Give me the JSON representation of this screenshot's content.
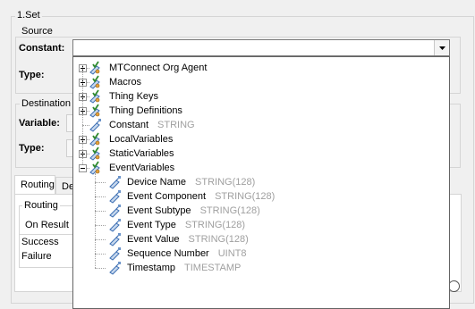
{
  "set_group": {
    "title": "1.Set"
  },
  "source": {
    "title": "Source",
    "constant_label": "Constant:",
    "constant_value": "",
    "type_label": "Type:"
  },
  "destination": {
    "title": "Destination",
    "variable_label": "Variable:",
    "type_label": "Type:"
  },
  "tabs": [
    {
      "label": "Routing",
      "selected": true
    },
    {
      "label": "Def",
      "selected": false
    }
  ],
  "routing": {
    "title": "Routing",
    "on_result_label": "On Result",
    "rows": [
      "Success",
      "Failure"
    ]
  },
  "tree": [
    {
      "label": "MTConnect Org Agent",
      "type": "",
      "level": 0,
      "expander": "plus",
      "icon": "folder-check-icon"
    },
    {
      "label": "Macros",
      "type": "",
      "level": 0,
      "expander": "plus",
      "icon": "folder-check-icon"
    },
    {
      "label": "Thing Keys",
      "type": "",
      "level": 0,
      "expander": "plus",
      "icon": "folder-check-icon"
    },
    {
      "label": "Thing Definitions",
      "type": "",
      "level": 0,
      "expander": "plus",
      "icon": "folder-check-icon"
    },
    {
      "label": "Constant",
      "type": "STRING",
      "level": 0,
      "expander": "none",
      "icon": "variable-icon"
    },
    {
      "label": "LocalVariables",
      "type": "",
      "level": 0,
      "expander": "plus",
      "icon": "folder-check-icon"
    },
    {
      "label": "StaticVariables",
      "type": "",
      "level": 0,
      "expander": "plus",
      "icon": "folder-check-icon"
    },
    {
      "label": "EventVariables",
      "type": "",
      "level": 0,
      "expander": "minus",
      "icon": "folder-check-icon"
    },
    {
      "label": "Device Name",
      "type": "STRING(128)",
      "level": 1,
      "expander": "none",
      "icon": "variable-icon"
    },
    {
      "label": "Event Component",
      "type": "STRING(128)",
      "level": 1,
      "expander": "none",
      "icon": "variable-icon"
    },
    {
      "label": "Event Subtype",
      "type": "STRING(128)",
      "level": 1,
      "expander": "none",
      "icon": "variable-icon"
    },
    {
      "label": "Event Type",
      "type": "STRING(128)",
      "level": 1,
      "expander": "none",
      "icon": "variable-icon"
    },
    {
      "label": "Event Value",
      "type": "STRING(128)",
      "level": 1,
      "expander": "none",
      "icon": "variable-icon"
    },
    {
      "label": "Sequence Number",
      "type": "UINT8",
      "level": 1,
      "expander": "none",
      "icon": "variable-icon"
    },
    {
      "label": "Timestamp",
      "type": "TIMESTAMP",
      "level": 1,
      "expander": "none",
      "icon": "variable-icon"
    }
  ]
}
